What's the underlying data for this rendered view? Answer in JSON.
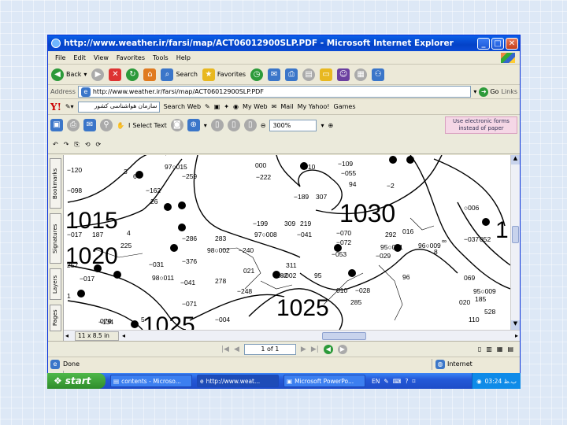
{
  "window": {
    "title": "http://www.weather.ir/farsi/map/ACT06012900SLP.PDF - Microsoft Internet Explorer",
    "min": "_",
    "max": "□",
    "close": "✕"
  },
  "menu": [
    "File",
    "Edit",
    "View",
    "Favorites",
    "Tools",
    "Help"
  ],
  "toolbar": {
    "back": "Back",
    "search": "Search",
    "favorites": "Favorites"
  },
  "address": {
    "label": "Address",
    "url": "http://www.weather.ir/farsi/map/ACT06012900SLP.PDF",
    "go": "Go",
    "links": "Links"
  },
  "yahoo": {
    "logo": "Y!",
    "search_text": "سازمان هواشناسی کشور",
    "search_web": "Search Web",
    "my_web": "My Web",
    "mail": "Mail",
    "my_yahoo": "My Yahoo!",
    "games": "Games"
  },
  "pdf_toolbar": {
    "select_text": "Select Text",
    "zoom": "300%",
    "electronic_forms": "Use electronic forms instead of paper"
  },
  "side_tabs": [
    "Bookmarks",
    "Signatures",
    "Layers",
    "Pages"
  ],
  "page_size": "11 x 8.5 in",
  "page_nav": "1 of 1",
  "map": {
    "isobars": [
      "1015",
      "1020",
      "1030",
      "1025",
      "1025",
      "1"
    ],
    "station_labels": [
      "97○015",
      "000",
      "○010",
      "−109",
      "−055",
      "94",
      "−2",
      "−259",
      "−222",
      "−189",
      "307",
      "−199",
      "309",
      "219",
      "97○008",
      "−041",
      "−070",
      "−072",
      "292",
      "95○001",
      "96○009",
      "−120",
      "−098",
      "−017",
      "187",
      "−286",
      "283",
      "98○002",
      "−240",
      "225",
      "−162",
      "26",
      "−031",
      "98○011",
      "257",
      "−376",
      "−041",
      "278",
      "−071",
      "−004",
      "−134",
      "182",
      "○002",
      "95",
      "96",
      "010",
      "311",
      "−053",
      "−029",
      "−028",
      "285",
      "○006",
      "020",
      "−037",
      "052",
      "069",
      "95○009",
      "185",
      "528",
      "110",
      "07○",
      "−017",
      "021",
      "−248",
      "016",
      "1",
      "5",
      "3",
      "6",
      "9",
      "4",
      "8",
      "∞",
      "070"
    ]
  },
  "status": {
    "left": "Done",
    "zone": "Internet"
  },
  "taskbar": {
    "start": "start",
    "tasks": [
      "contents - Microso...",
      "http://www.weat...",
      "Microsoft PowerPo..."
    ],
    "lang": "EN",
    "clock": "03:24 ب.ظ"
  }
}
